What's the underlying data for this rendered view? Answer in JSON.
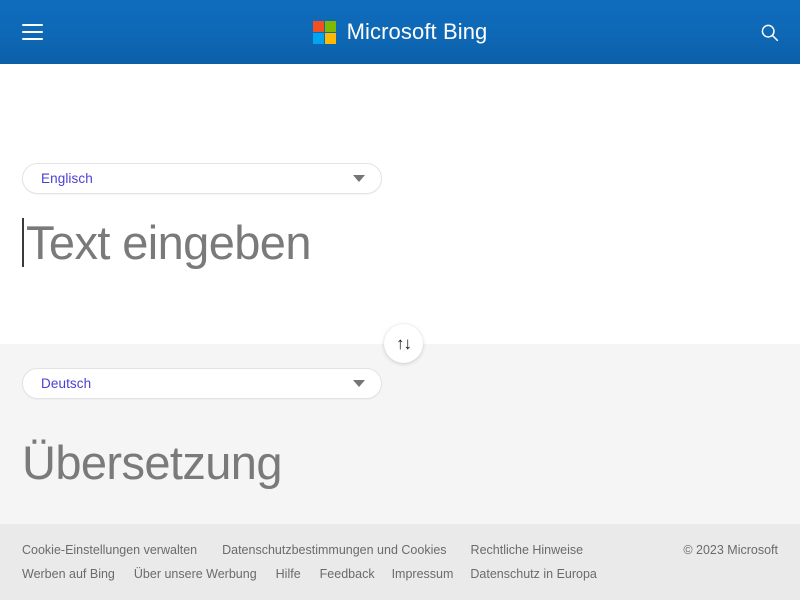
{
  "header": {
    "menu_icon": "hamburger-menu-icon",
    "brand_name": "Microsoft Bing",
    "logo_icon": "microsoft-logo-icon",
    "search_icon": "search-icon",
    "background_color": "#0f6cbd",
    "logo_colors": {
      "top_left": "#f25022",
      "top_right": "#7fba00",
      "bottom_left": "#00a4ef",
      "bottom_right": "#ffb900"
    }
  },
  "translator": {
    "source": {
      "language": "Englisch",
      "dropdown_icon": "chevron-down-icon",
      "placeholder": "Text eingeben",
      "mic_icon": "microphone-icon",
      "keyboard_icon": "keyboard-icon"
    },
    "swap": {
      "label": "↑↓",
      "icon": "swap-languages-icon"
    },
    "target": {
      "language": "Deutsch",
      "dropdown_icon": "chevron-down-icon",
      "placeholder": "Übersetzung"
    },
    "accent_color": "#4a3fd4",
    "placeholder_color": "#7a7a7a"
  },
  "footer": {
    "row1": [
      "Cookie-Einstellungen verwalten",
      "Datenschutzbestimmungen und Cookies",
      "Rechtliche Hinweise"
    ],
    "row2": [
      "Werben auf Bing",
      "Über unsere Werbung",
      "Hilfe",
      "Feedback",
      "Impressum",
      "Datenschutz in Europa"
    ],
    "copyright": "© 2023 Microsoft",
    "background_color": "#eaeaea",
    "link_color": "#6b6b6b"
  }
}
